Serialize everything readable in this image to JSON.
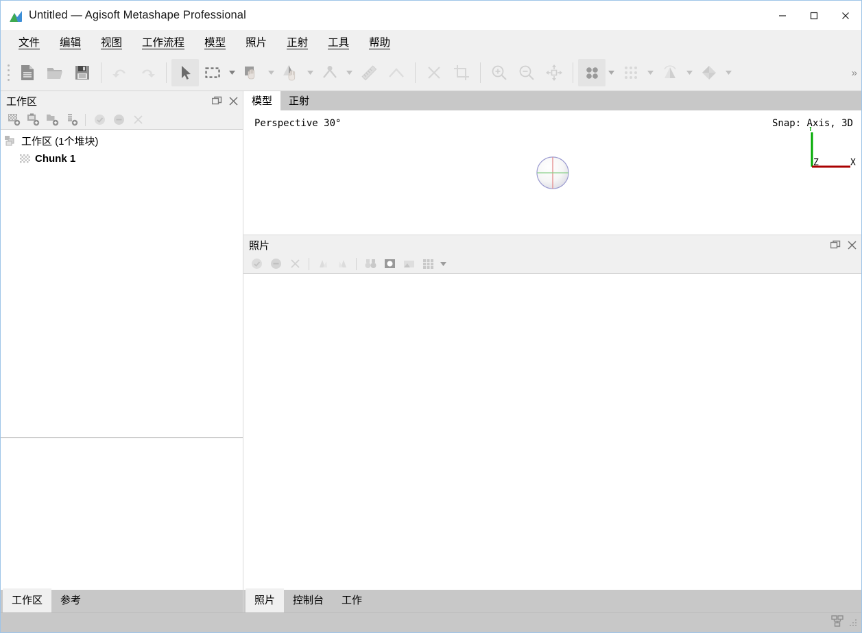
{
  "window": {
    "title": "Untitled — Agisoft Metashape Professional",
    "logo_icon": "metashape-logo-icon",
    "minimize_label": "–",
    "maximize_label": "☐",
    "close_label": "✕"
  },
  "menubar": {
    "items": [
      {
        "label": "文件",
        "mnemonic": "文"
      },
      {
        "label": "编辑",
        "mnemonic": "编"
      },
      {
        "label": "视图",
        "mnemonic": "视"
      },
      {
        "label": "工作流程",
        "mnemonic": "工作流程"
      },
      {
        "label": "模型",
        "mnemonic": "模"
      },
      {
        "label": "照片",
        "mnemonic": ""
      },
      {
        "label": "正射",
        "mnemonic": "正射"
      },
      {
        "label": "工具",
        "mnemonic": "工"
      },
      {
        "label": "帮助",
        "mnemonic": "帮"
      }
    ]
  },
  "toolbar": {
    "overflow_label": "»",
    "buttons": [
      {
        "name": "new-project-button",
        "icon": "new-document-icon",
        "enabled": true,
        "active": false
      },
      {
        "name": "open-project-button",
        "icon": "open-folder-icon",
        "enabled": true,
        "active": false
      },
      {
        "name": "save-project-button",
        "icon": "save-floppy-icon",
        "enabled": true,
        "active": false
      },
      {
        "name": "undo-button",
        "icon": "undo-arrow-icon",
        "enabled": false,
        "active": false
      },
      {
        "name": "redo-button",
        "icon": "redo-arrow-icon",
        "enabled": false,
        "active": false
      },
      {
        "name": "navigation-tool-button",
        "icon": "cursor-arrow-icon",
        "enabled": true,
        "active": true
      },
      {
        "name": "rectangle-selection-button",
        "icon": "dashed-rectangle-icon",
        "enabled": true,
        "active": false
      },
      {
        "name": "move-region-button",
        "icon": "move-region-hand-icon",
        "enabled": true,
        "active": false
      },
      {
        "name": "resize-region-button",
        "icon": "resize-region-hand-icon",
        "enabled": false,
        "active": false
      },
      {
        "name": "rotate-region-button",
        "icon": "rotate-region-icon",
        "enabled": false,
        "active": false
      },
      {
        "name": "ruler-button",
        "icon": "ruler-icon",
        "enabled": false,
        "active": false
      },
      {
        "name": "draw-polyline-button",
        "icon": "polyline-icon",
        "enabled": false,
        "active": false
      },
      {
        "name": "delete-selection-button",
        "icon": "cross-delete-icon",
        "enabled": false,
        "active": false
      },
      {
        "name": "crop-selection-button",
        "icon": "crop-icon",
        "enabled": false,
        "active": false
      },
      {
        "name": "zoom-in-button",
        "icon": "magnifier-plus-icon",
        "enabled": false,
        "active": false
      },
      {
        "name": "zoom-out-button",
        "icon": "magnifier-minus-icon",
        "enabled": false,
        "active": false
      },
      {
        "name": "reset-view-button",
        "icon": "fit-to-view-icon",
        "enabled": false,
        "active": false
      },
      {
        "name": "point-cloud-view-button",
        "icon": "four-dots-icon",
        "enabled": true,
        "active": true
      },
      {
        "name": "dense-cloud-view-button",
        "icon": "nine-dots-icon",
        "enabled": false,
        "active": false
      },
      {
        "name": "mesh-shaded-view-button",
        "icon": "shaded-mesh-icon",
        "enabled": false,
        "active": false
      },
      {
        "name": "model-solid-view-button",
        "icon": "solid-model-icon",
        "enabled": false,
        "active": false
      }
    ]
  },
  "workspace_panel": {
    "title": "工作区",
    "float_button_label": "undock",
    "close_button_label": "close",
    "toolbar_icons": [
      {
        "name": "add-chunk-button",
        "icon": "add-chunk-icon",
        "enabled": true
      },
      {
        "name": "add-photos-button",
        "icon": "add-photos-icon",
        "enabled": true
      },
      {
        "name": "add-folder-button",
        "icon": "add-folder-icon",
        "enabled": true
      },
      {
        "name": "add-marker-button",
        "icon": "add-marker-icon",
        "enabled": true
      },
      {
        "name": "enable-button",
        "icon": "check-circle-icon",
        "enabled": false
      },
      {
        "name": "disable-button",
        "icon": "minus-circle-icon",
        "enabled": false
      },
      {
        "name": "remove-items-button",
        "icon": "cross-icon",
        "enabled": false
      }
    ],
    "tree": {
      "root": {
        "label": "工作区 (1个堆块)",
        "icon": "workspace-tree-icon"
      },
      "children": [
        {
          "label": "Chunk 1",
          "icon": "chunk-icon",
          "bold": true
        }
      ]
    },
    "tabs": [
      {
        "label": "工作区",
        "selected": true
      },
      {
        "label": "参考",
        "selected": false
      }
    ]
  },
  "view_area": {
    "tabs": [
      {
        "label": "模型",
        "selected": true
      },
      {
        "label": "正射",
        "selected": false
      }
    ],
    "projection_label": "Perspective 30°",
    "snap_label": "Snap: Axis, 3D",
    "axis_labels": {
      "x": "X",
      "y": "Y",
      "z": "Z"
    },
    "axis_colors": {
      "x": "#aa0000",
      "y": "#00aa00",
      "z": "#0000cc"
    },
    "trackball_icon": "view-trackball-icon"
  },
  "photos_panel": {
    "title": "照片",
    "float_button_label": "undock",
    "close_button_label": "close",
    "toolbar_icons": [
      {
        "name": "enable-photos-button",
        "icon": "check-circle-icon",
        "enabled": false
      },
      {
        "name": "disable-photos-button",
        "icon": "minus-circle-icon",
        "enabled": false
      },
      {
        "name": "remove-photos-button",
        "icon": "cross-icon",
        "enabled": false
      },
      {
        "name": "reset-camera-alignment-button",
        "icon": "reset-alignment-icon",
        "enabled": false
      },
      {
        "name": "reset-current-alignment-button",
        "icon": "reset-current-alignment-icon",
        "enabled": false
      },
      {
        "name": "match-photos-button",
        "icon": "binoculars-icon",
        "enabled": false
      },
      {
        "name": "photo-details-button",
        "icon": "photo-detail-icon",
        "enabled": false
      },
      {
        "name": "photo-thumbnail-button",
        "icon": "photo-thumbnail-icon",
        "enabled": false
      },
      {
        "name": "thumbnail-grid-button",
        "icon": "grid-icon",
        "enabled": false
      }
    ],
    "tabs": [
      {
        "label": "照片",
        "selected": true
      },
      {
        "label": "控制台",
        "selected": false
      },
      {
        "label": "工作",
        "selected": false
      }
    ]
  },
  "statusbar": {
    "message": "",
    "network_icon": "network-processing-icon",
    "resize_grip_icon": "resize-grip-icon"
  }
}
